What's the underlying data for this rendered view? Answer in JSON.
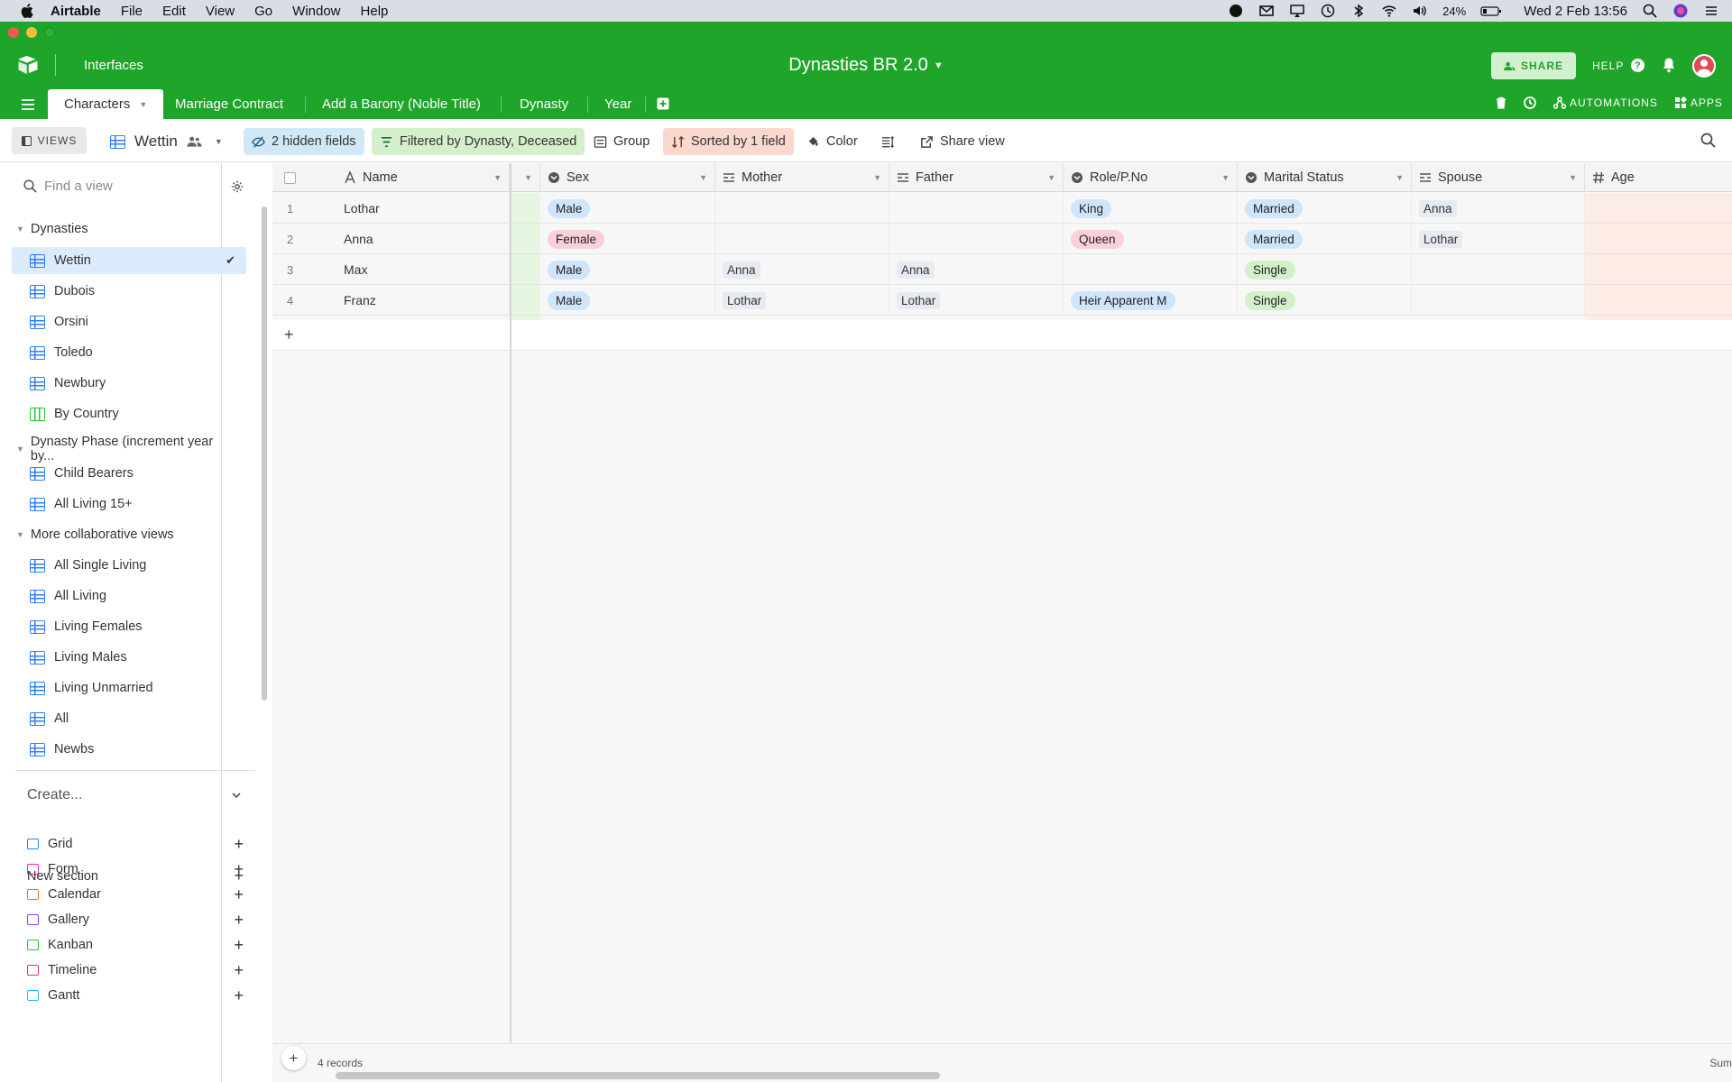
{
  "mac_menubar": {
    "app_name": "Airtable",
    "menus": [
      "File",
      "Edit",
      "View",
      "Go",
      "Window",
      "Help"
    ],
    "battery": "24%",
    "datetime": "Wed 2 Feb  13:56"
  },
  "header": {
    "interfaces_label": "Interfaces",
    "base_title": "Dynasties BR 2.0",
    "share_label": "SHARE",
    "help_label": "HELP",
    "automations_label": "AUTOMATIONS",
    "apps_label": "APPS",
    "brand_color": "#20a52b"
  },
  "tabs": [
    {
      "label": "Characters",
      "active": true
    },
    {
      "label": "Marriage Contract",
      "active": false
    },
    {
      "label": "Add a Barony (Noble Title)",
      "active": false
    },
    {
      "label": "Dynasty",
      "active": false
    },
    {
      "label": "Year",
      "active": false
    }
  ],
  "toolbar": {
    "views_label": "VIEWS",
    "current_view": "Wettin",
    "hidden_fields": "2 hidden fields",
    "filter": "Filtered by Dynasty, Deceased",
    "group": "Group",
    "sort": "Sorted by 1 field",
    "color": "Color",
    "share_view": "Share view"
  },
  "sidebar": {
    "find_placeholder": "Find a view",
    "sections": [
      {
        "title": "Dynasties",
        "items": [
          {
            "label": "Wettin",
            "icon": "grid-icon",
            "selected": true
          },
          {
            "label": "Dubois",
            "icon": "grid-icon"
          },
          {
            "label": "Orsini",
            "icon": "grid-icon"
          },
          {
            "label": "Toledo",
            "icon": "grid-icon"
          },
          {
            "label": "Newbury",
            "icon": "grid-icon"
          },
          {
            "label": "By Country",
            "icon": "kanban-icon"
          }
        ]
      },
      {
        "title": "Dynasty Phase (increment year by...",
        "items": [
          {
            "label": "Child Bearers",
            "icon": "grid-icon"
          },
          {
            "label": "All Living 15+",
            "icon": "grid-icon"
          }
        ]
      },
      {
        "title": "More collaborative views",
        "items": [
          {
            "label": "All Single Living",
            "icon": "grid-icon"
          },
          {
            "label": "All Living",
            "icon": "grid-icon"
          },
          {
            "label": "Living Females",
            "icon": "grid-icon"
          },
          {
            "label": "Living Males",
            "icon": "grid-icon"
          },
          {
            "label": "Living Unmarried",
            "icon": "grid-icon"
          },
          {
            "label": "All",
            "icon": "grid-icon"
          },
          {
            "label": "Newbs",
            "icon": "grid-icon"
          }
        ]
      }
    ],
    "create_label": "Create...",
    "create_items": [
      {
        "label": "Grid",
        "color": "#2d7ff9"
      },
      {
        "label": "Form",
        "color": "#e929ba"
      },
      {
        "label": "Calendar",
        "color": "#ff6f2c"
      },
      {
        "label": "Gallery",
        "color": "#8b46ff"
      },
      {
        "label": "Kanban",
        "color": "#20c933"
      },
      {
        "label": "Timeline",
        "color": "#f82b60"
      },
      {
        "label": "Gantt",
        "color": "#18bfff"
      }
    ],
    "new_section_label": "New section"
  },
  "grid": {
    "columns": {
      "name": "Name",
      "sex": "Sex",
      "mother": "Mother",
      "father": "Father",
      "role": "Role/P.No",
      "marital": "Marital Status",
      "spouse": "Spouse",
      "age": "Age"
    },
    "rows": [
      {
        "num": "1",
        "name": "Lothar",
        "sex": "Male",
        "mother": "",
        "father": "",
        "role": "King",
        "marital": "Married",
        "spouse": "Anna"
      },
      {
        "num": "2",
        "name": "Anna",
        "sex": "Female",
        "mother": "",
        "father": "",
        "role": "Queen",
        "marital": "Married",
        "spouse": "Lothar"
      },
      {
        "num": "3",
        "name": "Max",
        "sex": "Male",
        "mother": "Anna",
        "father": "Anna",
        "role": "",
        "marital": "Single",
        "spouse": ""
      },
      {
        "num": "4",
        "name": "Franz",
        "sex": "Male",
        "mother": "Lothar",
        "father": "Lothar",
        "role": "Heir Apparent M",
        "marital": "Single",
        "spouse": ""
      }
    ],
    "record_count": "4 records",
    "summary_label": "Sum"
  }
}
